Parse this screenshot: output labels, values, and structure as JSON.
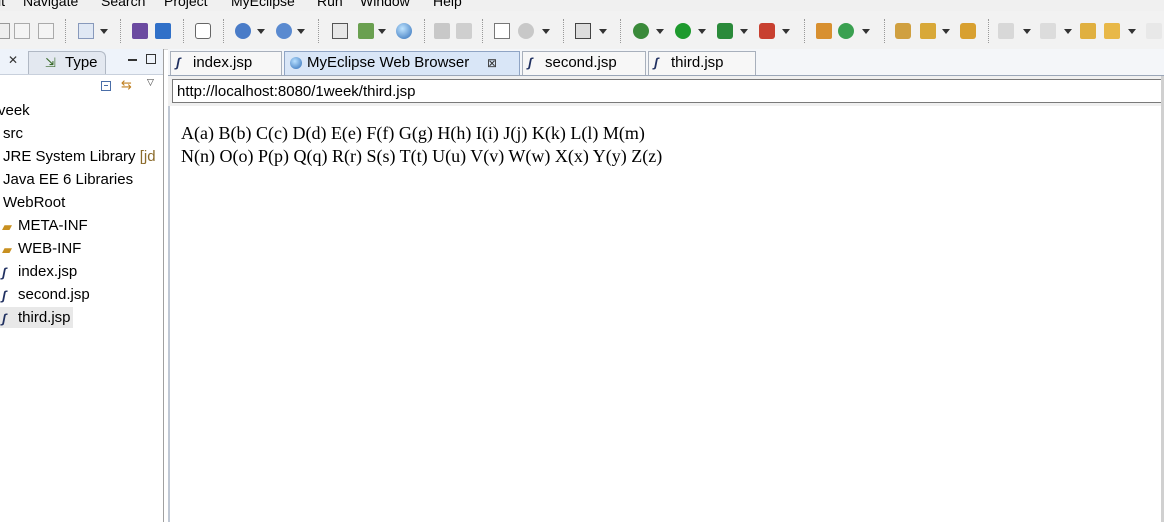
{
  "menu": [
    "it",
    "Navigate",
    "Search",
    "Project",
    "MyEclipse",
    "Run",
    "Window",
    "Help"
  ],
  "left_panel": {
    "type_tab_label": "Type",
    "tree": [
      {
        "label": "veek",
        "icon": "project-icon",
        "extra": ""
      },
      {
        "label": "src",
        "icon": "source-folder-icon",
        "extra": ""
      },
      {
        "label": "JRE System Library",
        "icon": "library-icon",
        "extra": "[jd"
      },
      {
        "label": "Java EE 6 Libraries",
        "icon": "library-icon",
        "extra": ""
      },
      {
        "label": "WebRoot",
        "icon": "web-folder-icon",
        "extra": ""
      },
      {
        "label": "META-INF",
        "icon": "folder-icon",
        "extra": ""
      },
      {
        "label": "WEB-INF",
        "icon": "folder-icon",
        "extra": ""
      },
      {
        "label": "index.jsp",
        "icon": "jsp-file-icon",
        "extra": ""
      },
      {
        "label": "second.jsp",
        "icon": "jsp-file-icon",
        "extra": ""
      },
      {
        "label": "third.jsp",
        "icon": "jsp-file-icon",
        "extra": "",
        "selected": true
      }
    ]
  },
  "editor": {
    "tabs": [
      {
        "label": "index.jsp",
        "icon": "jsp-file-icon"
      },
      {
        "label": "MyEclipse Web Browser",
        "icon": "globe-icon",
        "active": true
      },
      {
        "label": "second.jsp",
        "icon": "jsp-file-icon"
      },
      {
        "label": "third.jsp",
        "icon": "jsp-file-icon"
      }
    ],
    "address": "http://localhost:8080/1week/third.jsp"
  },
  "browser": {
    "line1": "A(a) B(b) C(c) D(d) E(e) F(f) G(g) H(h) I(i) J(j) K(k) L(l) M(m)",
    "line2": "N(n) O(o) P(p) Q(q) R(r) S(s) T(t) U(u) V(v) W(w) X(x) Y(y) Z(z)"
  }
}
